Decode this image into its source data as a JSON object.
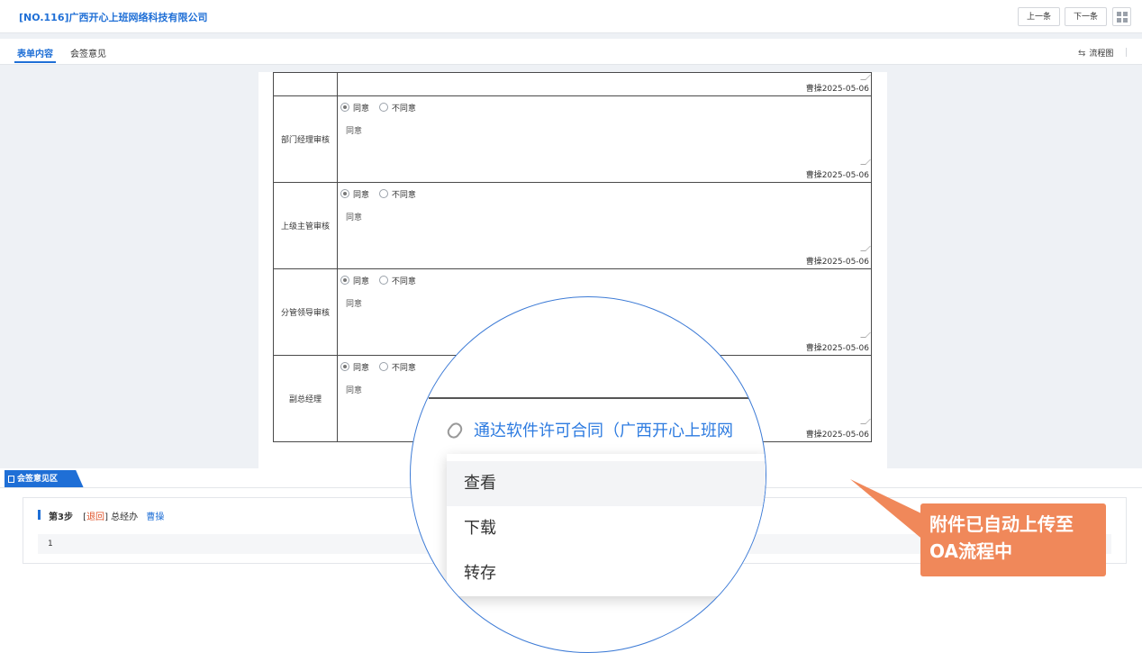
{
  "header": {
    "title": "[NO.116]广西开心上班网络科技有限公司",
    "prev_label": "上一条",
    "next_label": "下一条"
  },
  "tabs": [
    {
      "label": "表单内容",
      "active": true
    },
    {
      "label": "会签意见",
      "active": false
    }
  ],
  "flowchart_label": "流程图",
  "form": {
    "options": {
      "agree": "同意",
      "disagree": "不同意"
    },
    "first_row": {
      "signer": "曹操2025-05-06"
    },
    "rows": [
      {
        "label": "部门经理审核",
        "selected": "agree",
        "opinion": "同意",
        "signer": "曹操2025-05-06"
      },
      {
        "label": "上级主管审核",
        "selected": "agree",
        "opinion": "同意",
        "signer": "曹操2025-05-06"
      },
      {
        "label": "分管领导审核",
        "selected": "agree",
        "opinion": "同意",
        "signer": "曹操2025-05-06"
      },
      {
        "label": "副总经理",
        "selected": "agree",
        "opinion": "同意",
        "signer": "曹操2025-05-06"
      }
    ]
  },
  "countersign": {
    "section_title": "会签意见区",
    "step": "第3步",
    "status_open": "[",
    "status": "退回",
    "status_close": "]",
    "dept": "总经办",
    "person": "曹操",
    "comment": "1"
  },
  "magnifier": {
    "attachment_name": "通达软件许可合同（广西开心上班网",
    "menu": [
      "查看",
      "下载",
      "转存"
    ]
  },
  "callout": {
    "line1": "附件已自动上传至",
    "line2": "OA流程中"
  },
  "colors": {
    "accent": "#1f6fd6",
    "status_back": "#e0532a",
    "callout": "#f0885a",
    "link": "#2d7be0"
  }
}
